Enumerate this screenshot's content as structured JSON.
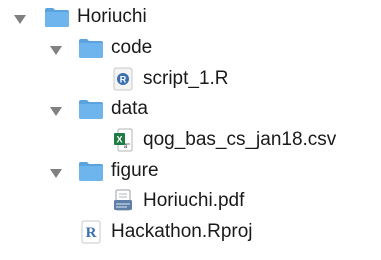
{
  "tree": {
    "root": {
      "name": "Horiuchi",
      "icon": "folder-icon",
      "expanded": true,
      "children": [
        {
          "name": "code",
          "icon": "folder-icon",
          "expanded": true,
          "children": [
            {
              "name": "script_1.R",
              "icon": "r-script-file-icon"
            }
          ]
        },
        {
          "name": "data",
          "icon": "folder-icon",
          "expanded": true,
          "children": [
            {
              "name": "qog_bas_cs_jan18.csv",
              "icon": "csv-spreadsheet-file-icon"
            }
          ]
        },
        {
          "name": "figure",
          "icon": "folder-icon",
          "expanded": true,
          "children": [
            {
              "name": "Horiuchi.pdf",
              "icon": "pdf-preview-file-icon"
            }
          ]
        },
        {
          "name": "Hackathon.Rproj",
          "icon": "rproj-file-icon"
        }
      ]
    }
  },
  "colors": {
    "folder_body": "#6fb5ed",
    "folder_tab": "#5aa3df",
    "disclosure": "#808080",
    "text": "#1a1a1a",
    "r_blue": "#3a6fb0",
    "csv_green": "#1f7a44"
  }
}
